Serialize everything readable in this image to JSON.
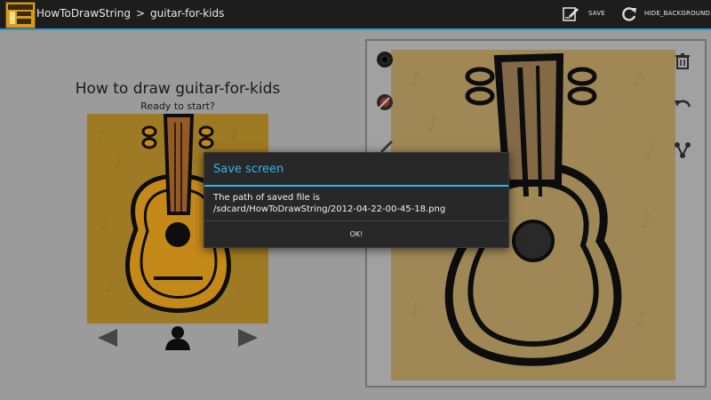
{
  "actionbar": {
    "app_name": "HowToDrawString",
    "separator": ">",
    "page": "guitar-for-kids",
    "save_label": "SAVE",
    "hide_bg_label": "HIDE_BACKGROUND",
    "accent": "#2f98c9"
  },
  "lesson": {
    "title": "How to draw guitar-for-kids",
    "subtitle": "Ready to start?"
  },
  "icons": {
    "save": "save-icon",
    "hide_background": "refresh-icon",
    "prev": "left-arrow-icon",
    "next": "right-arrow-icon",
    "person": "person-icon",
    "tools": [
      "brush-size-icon",
      "color-picker-icon",
      "pencil-icon",
      "trash-icon",
      "undo-icon",
      "share-icon"
    ]
  },
  "dialog": {
    "title": "Save screen",
    "message_line1": "The path of saved file is",
    "message_line2": "/sdcard/HowToDrawString/2012-04-22-00-45-18.png",
    "ok_label": "OK!",
    "accent": "#33b5e5"
  }
}
